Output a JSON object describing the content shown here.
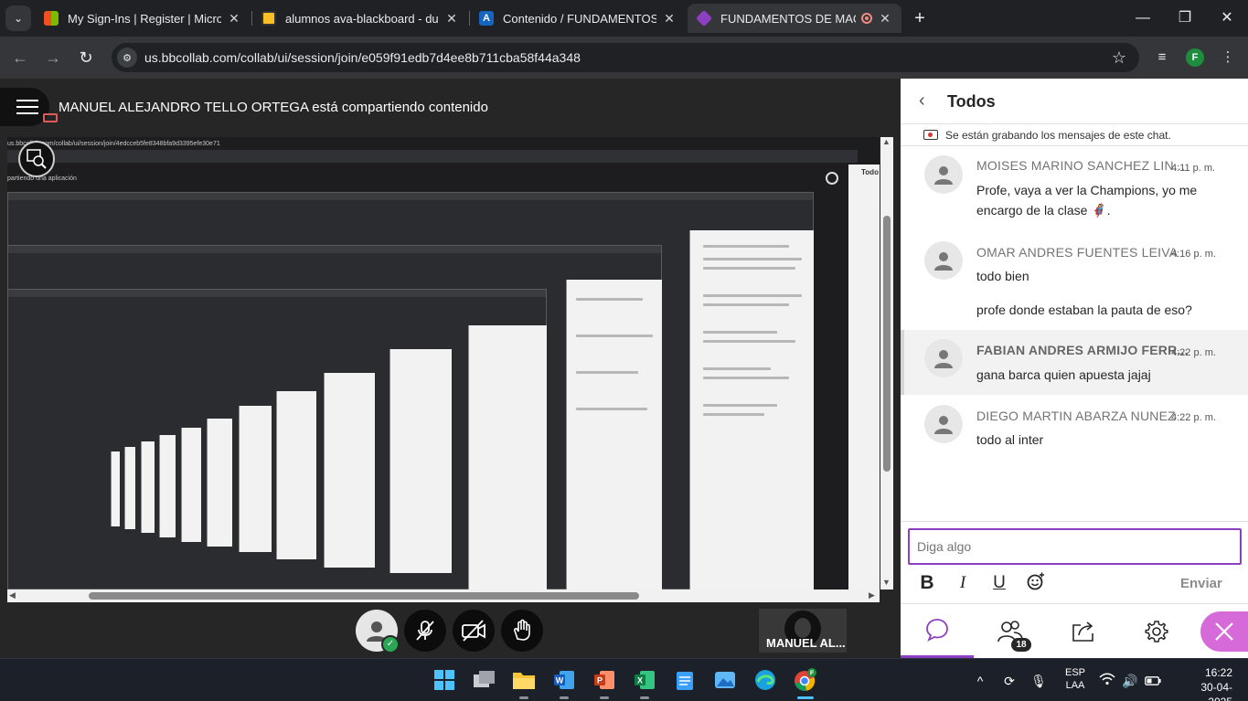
{
  "browser": {
    "tabs": [
      {
        "title": "My Sign-Ins | Register | Microsoft",
        "favicon_color": "#f25022"
      },
      {
        "title": "alumnos ava-blackboard - duoc",
        "favicon_color": "#f6c026"
      },
      {
        "title": "Contenido / FUNDAMENTOS DE MACHINE",
        "favicon_color": "#1565c0"
      },
      {
        "title": "FUNDAMENTOS DE MACHINE",
        "favicon_color": "#8d3fc1"
      }
    ],
    "url": "us.bbcollab.com/collab/ui/session/join/e059f91edb7d4ee8b711cba58f44a348",
    "profile_initial": "F"
  },
  "session": {
    "sharing_banner": "MANUEL ALEJANDRO TELLO ORTEGA está compartiendo contenido",
    "participant_tile_name": "MANUEL AL...",
    "shared_content": {
      "url_text": "us.bbcollab.com/collab/ui/session/join/4edcceb5fe8348bfa9d3395efe30e71",
      "sharing_caption": "partiendo una aplicación",
      "panel_title": "Todo"
    }
  },
  "chat": {
    "title": "Todos",
    "recording_note": "Se están grabando los mensajes de este chat.",
    "messages": [
      {
        "author": "MOISES MARINO SANCHEZ LIN...",
        "time": "4:11 p. m.",
        "text": "Profe, vaya a ver la Champions, yo me encargo de la clase 🦸‍♀️."
      },
      {
        "author": "OMAR ANDRES FUENTES LEIVA",
        "time": "4:16 p. m.",
        "text": "todo bien",
        "text2": "profe donde estaban la pauta de eso?"
      },
      {
        "author": "FABIAN ANDRES ARMIJO FERR...",
        "time": "4:22 p. m.",
        "text": "gana barca quien apuesta jajaj"
      },
      {
        "author": "DIEGO MARTIN ABARZA NUNEZ",
        "time": "4:22 p. m.",
        "text": "todo al inter"
      }
    ],
    "input_placeholder": "Diga algo",
    "send_label": "Enviar",
    "participants_count": "18"
  },
  "taskbar": {
    "language": "ESP",
    "layout": "LAA",
    "time": "16:22",
    "date": "30-04-2025"
  },
  "colors": {
    "accent": "#8d3fc1",
    "close_fab": "#d66ad9",
    "ok_badge": "#2aa654"
  }
}
